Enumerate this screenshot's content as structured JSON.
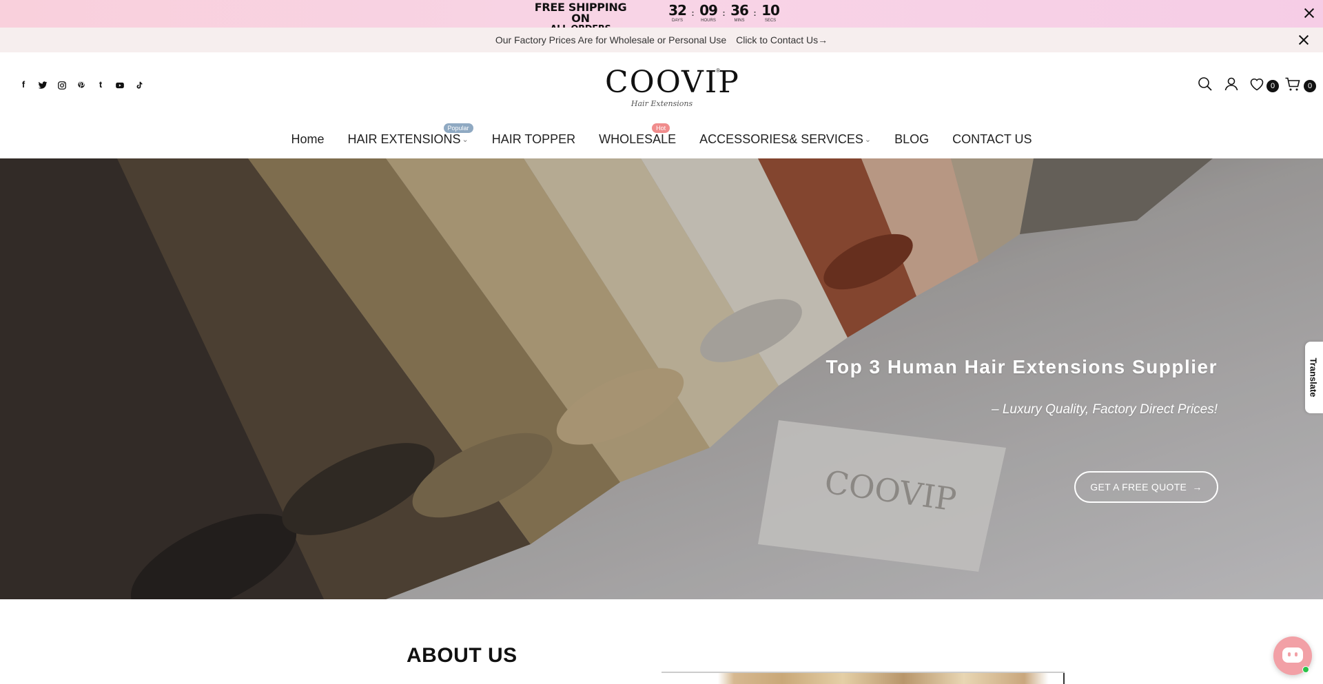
{
  "promo": {
    "line1": "FREE SHIPPING ON",
    "line2": "ALL ORDERS",
    "countdown": [
      {
        "value": "32",
        "label": "DAYS"
      },
      {
        "value": "09",
        "label": "HOURS"
      },
      {
        "value": "36",
        "label": "MINS"
      },
      {
        "value": "10",
        "label": "SECS"
      }
    ],
    "separator": ":"
  },
  "notice": {
    "text": "Our Factory Prices Are for Wholesale or Personal Use",
    "link": "Click to Contact Us→"
  },
  "social_icons": [
    "facebook-icon",
    "twitter-icon",
    "instagram-icon",
    "pinterest-icon",
    "tumblr-icon",
    "youtube-icon",
    "tiktok-icon"
  ],
  "logo": {
    "word": "COOVIP",
    "sub": "Hair Extensions",
    "reg": "®"
  },
  "header": {
    "wishlist_count": "0",
    "cart_count": "0"
  },
  "nav": {
    "items": [
      {
        "label": "Home"
      },
      {
        "label": "HAIR EXTENSIONS",
        "tag": "Popular"
      },
      {
        "label": "HAIR TOPPER"
      },
      {
        "label": "WHOLESALE",
        "tag": "Hot"
      },
      {
        "label": "ACCESSORIES& SERVICES"
      },
      {
        "label": "BLOG"
      },
      {
        "label": "CONTACT US"
      }
    ],
    "colors": {
      "popular": "#8fa9c2",
      "hot": "#f08c8c"
    }
  },
  "hero": {
    "title": "Top 3 Human Hair Extensions Supplier",
    "subtitle": "– Luxury Quality, Factory Direct Prices!",
    "button": "GET A FREE QUOTE",
    "button_arrow": "→"
  },
  "translate": {
    "label": "Translate"
  },
  "about": {
    "title": "ABOUT US"
  }
}
